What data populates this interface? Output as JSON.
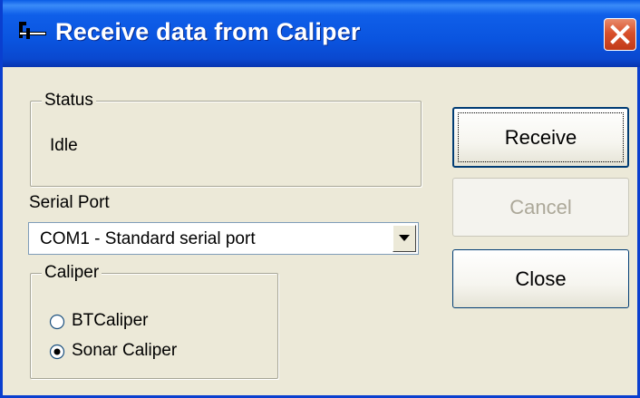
{
  "window": {
    "title": "Receive data from Caliper",
    "icons": {
      "app": "caliper-icon",
      "close": "close-icon"
    }
  },
  "status": {
    "group_label": "Status",
    "value": "Idle"
  },
  "serial_port": {
    "label": "Serial Port",
    "selected": "COM1 - Standard serial port"
  },
  "caliper": {
    "group_label": "Caliper",
    "options": [
      {
        "label": "BTCaliper",
        "selected": false
      },
      {
        "label": "Sonar Caliper",
        "selected": true
      }
    ]
  },
  "buttons": {
    "receive": "Receive",
    "cancel": "Cancel",
    "close": "Close"
  },
  "colors": {
    "titlebar": "#0a54df",
    "dialog_bg": "#ece9d8",
    "close_button": "#d9512c",
    "disabled_text": "#aca899"
  }
}
